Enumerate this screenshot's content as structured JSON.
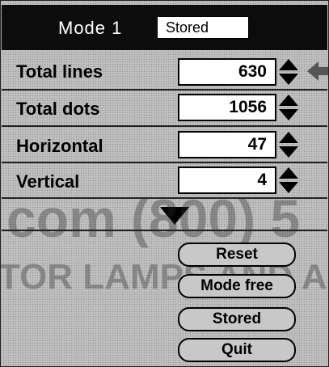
{
  "header": {
    "title": "Mode 1",
    "mode_value": "Stored"
  },
  "rows": [
    {
      "label": "Total lines",
      "value": "630"
    },
    {
      "label": "Total dots",
      "value": "1056"
    },
    {
      "label": "Horizontal",
      "value": "47"
    },
    {
      "label": "Vertical",
      "value": "4"
    }
  ],
  "buttons": [
    {
      "label": "Reset"
    },
    {
      "label": "Mode free"
    },
    {
      "label": "Stored"
    },
    {
      "label": "Quit"
    }
  ],
  "watermark": {
    "line1": "com (800) 5",
    "line2": "TOR LAMPS AND ACC"
  },
  "colors": {
    "header_bg": "#0c0c0c",
    "panel_bg": "#c8c8c8"
  },
  "icons": [
    "updown-spinner-icon",
    "left-arrow-icon",
    "scroll-down-arrow-icon"
  ]
}
